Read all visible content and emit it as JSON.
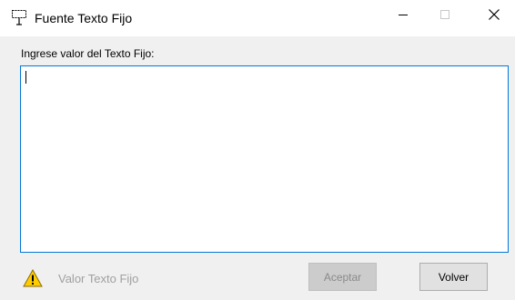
{
  "window": {
    "title": "Fuente Texto Fijo",
    "icon": "presentation-board-icon",
    "controls": {
      "minimize_icon": "minimize-icon",
      "maximize_icon": "maximize-icon",
      "close_icon": "close-icon"
    }
  },
  "form": {
    "field_label": "Ingrese valor del Texto Fijo:",
    "field_value": "",
    "field_focused": true
  },
  "footer": {
    "status_icon": "warning-icon",
    "status_text": "Valor Texto Fijo",
    "accept_label": "Aceptar",
    "accept_enabled": false,
    "back_label": "Volver"
  },
  "colors": {
    "focus_border": "#0078d7",
    "warning_fill": "#ffcc00",
    "disabled_text": "#a0a0a0"
  }
}
